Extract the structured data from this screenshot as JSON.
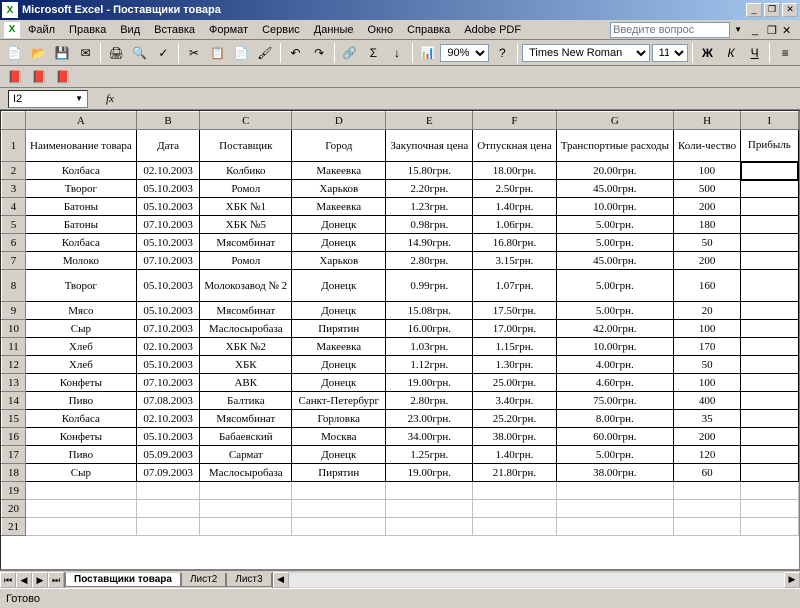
{
  "title": "Microsoft Excel - Поставщики товара",
  "menu": [
    "Файл",
    "Правка",
    "Вид",
    "Вставка",
    "Формат",
    "Сервис",
    "Данные",
    "Окно",
    "Справка",
    "Adobe PDF"
  ],
  "askPlaceholder": "Введите вопрос",
  "font": {
    "name": "Times New Roman",
    "size": "11"
  },
  "zoom": "90%",
  "namebox": "I2",
  "fxLabel": "fx",
  "cols": [
    "A",
    "B",
    "C",
    "D",
    "E",
    "F",
    "G",
    "H",
    "I"
  ],
  "headers": [
    "Наименование товара",
    "Дата",
    "Поставщик",
    "Город",
    "Закупочная цена",
    "Отпускная цена",
    "Транспортные расходы",
    "Коли-чество",
    "Прибыль"
  ],
  "rows": [
    [
      "Колбаса",
      "02.10.2003",
      "Колбико",
      "Макеевка",
      "15.80грн.",
      "18.00грн.",
      "20.00грн.",
      "100",
      ""
    ],
    [
      "Творог",
      "05.10.2003",
      "Ромол",
      "Харьков",
      "2.20грн.",
      "2.50грн.",
      "45.00грн.",
      "500",
      ""
    ],
    [
      "Батоны",
      "05.10.2003",
      "ХБК №1",
      "Макеевка",
      "1.23грн.",
      "1.40грн.",
      "10.00грн.",
      "200",
      ""
    ],
    [
      "Батоны",
      "07.10.2003",
      "ХБК №5",
      "Донецк",
      "0.98грн.",
      "1.06грн.",
      "5.00грн.",
      "180",
      ""
    ],
    [
      "Колбаса",
      "05.10.2003",
      "Мясомбинат",
      "Донецк",
      "14.90грн.",
      "16.80грн.",
      "5.00грн.",
      "50",
      ""
    ],
    [
      "Молоко",
      "07.10.2003",
      "Ромол",
      "Харьков",
      "2.80грн.",
      "3.15грн.",
      "45.00грн.",
      "200",
      ""
    ],
    [
      "Творог",
      "05.10.2003",
      "Молокозавод № 2",
      "Донецк",
      "0.99грн.",
      "1.07грн.",
      "5.00грн.",
      "160",
      ""
    ],
    [
      "Мясо",
      "05.10.2003",
      "Мясомбинат",
      "Донецк",
      "15.08грн.",
      "17.50грн.",
      "5.00грн.",
      "20",
      ""
    ],
    [
      "Сыр",
      "07.10.2003",
      "Маслосыробаза",
      "Пирятин",
      "16.00грн.",
      "17.00грн.",
      "42.00грн.",
      "100",
      ""
    ],
    [
      "Хлеб",
      "02.10.2003",
      "ХБК №2",
      "Макеевка",
      "1.03грн.",
      "1.15грн.",
      "10.00грн.",
      "170",
      ""
    ],
    [
      "Хлеб",
      "05.10.2003",
      "ХБК",
      "Донецк",
      "1.12грн.",
      "1.30грн.",
      "4.00грн.",
      "50",
      ""
    ],
    [
      "Конфеты",
      "07.10.2003",
      "АВК",
      "Донецк",
      "19.00грн.",
      "25.00грн.",
      "4.60грн.",
      "100",
      ""
    ],
    [
      "Пиво",
      "07.08.2003",
      "Балтика",
      "Санкт-Петербург",
      "2.80грн.",
      "3.40грн.",
      "75.00грн.",
      "400",
      ""
    ],
    [
      "Колбаса",
      "02.10.2003",
      "Мясомбинат",
      "Горловка",
      "23.00грн.",
      "25.20грн.",
      "8.00грн.",
      "35",
      ""
    ],
    [
      "Конфеты",
      "05.10.2003",
      "Бабаевский",
      "Москва",
      "34.00грн.",
      "38.00грн.",
      "60.00грн.",
      "200",
      ""
    ],
    [
      "Пиво",
      "05.09.2003",
      "Сармат",
      "Донецк",
      "1.25грн.",
      "1.40грн.",
      "5.00грн.",
      "120",
      ""
    ],
    [
      "Сыр",
      "07.09.2003",
      "Маслосыробаза",
      "Пирятин",
      "19.00грн.",
      "21.80грн.",
      "38.00грн.",
      "60",
      ""
    ]
  ],
  "emptyRows": [
    19,
    20,
    21
  ],
  "tabs": [
    "Поставщики товара",
    "Лист2",
    "Лист3"
  ],
  "status": "Готово",
  "formatBtns": {
    "bold": "Ж",
    "italic": "К",
    "underline": "Ч"
  }
}
